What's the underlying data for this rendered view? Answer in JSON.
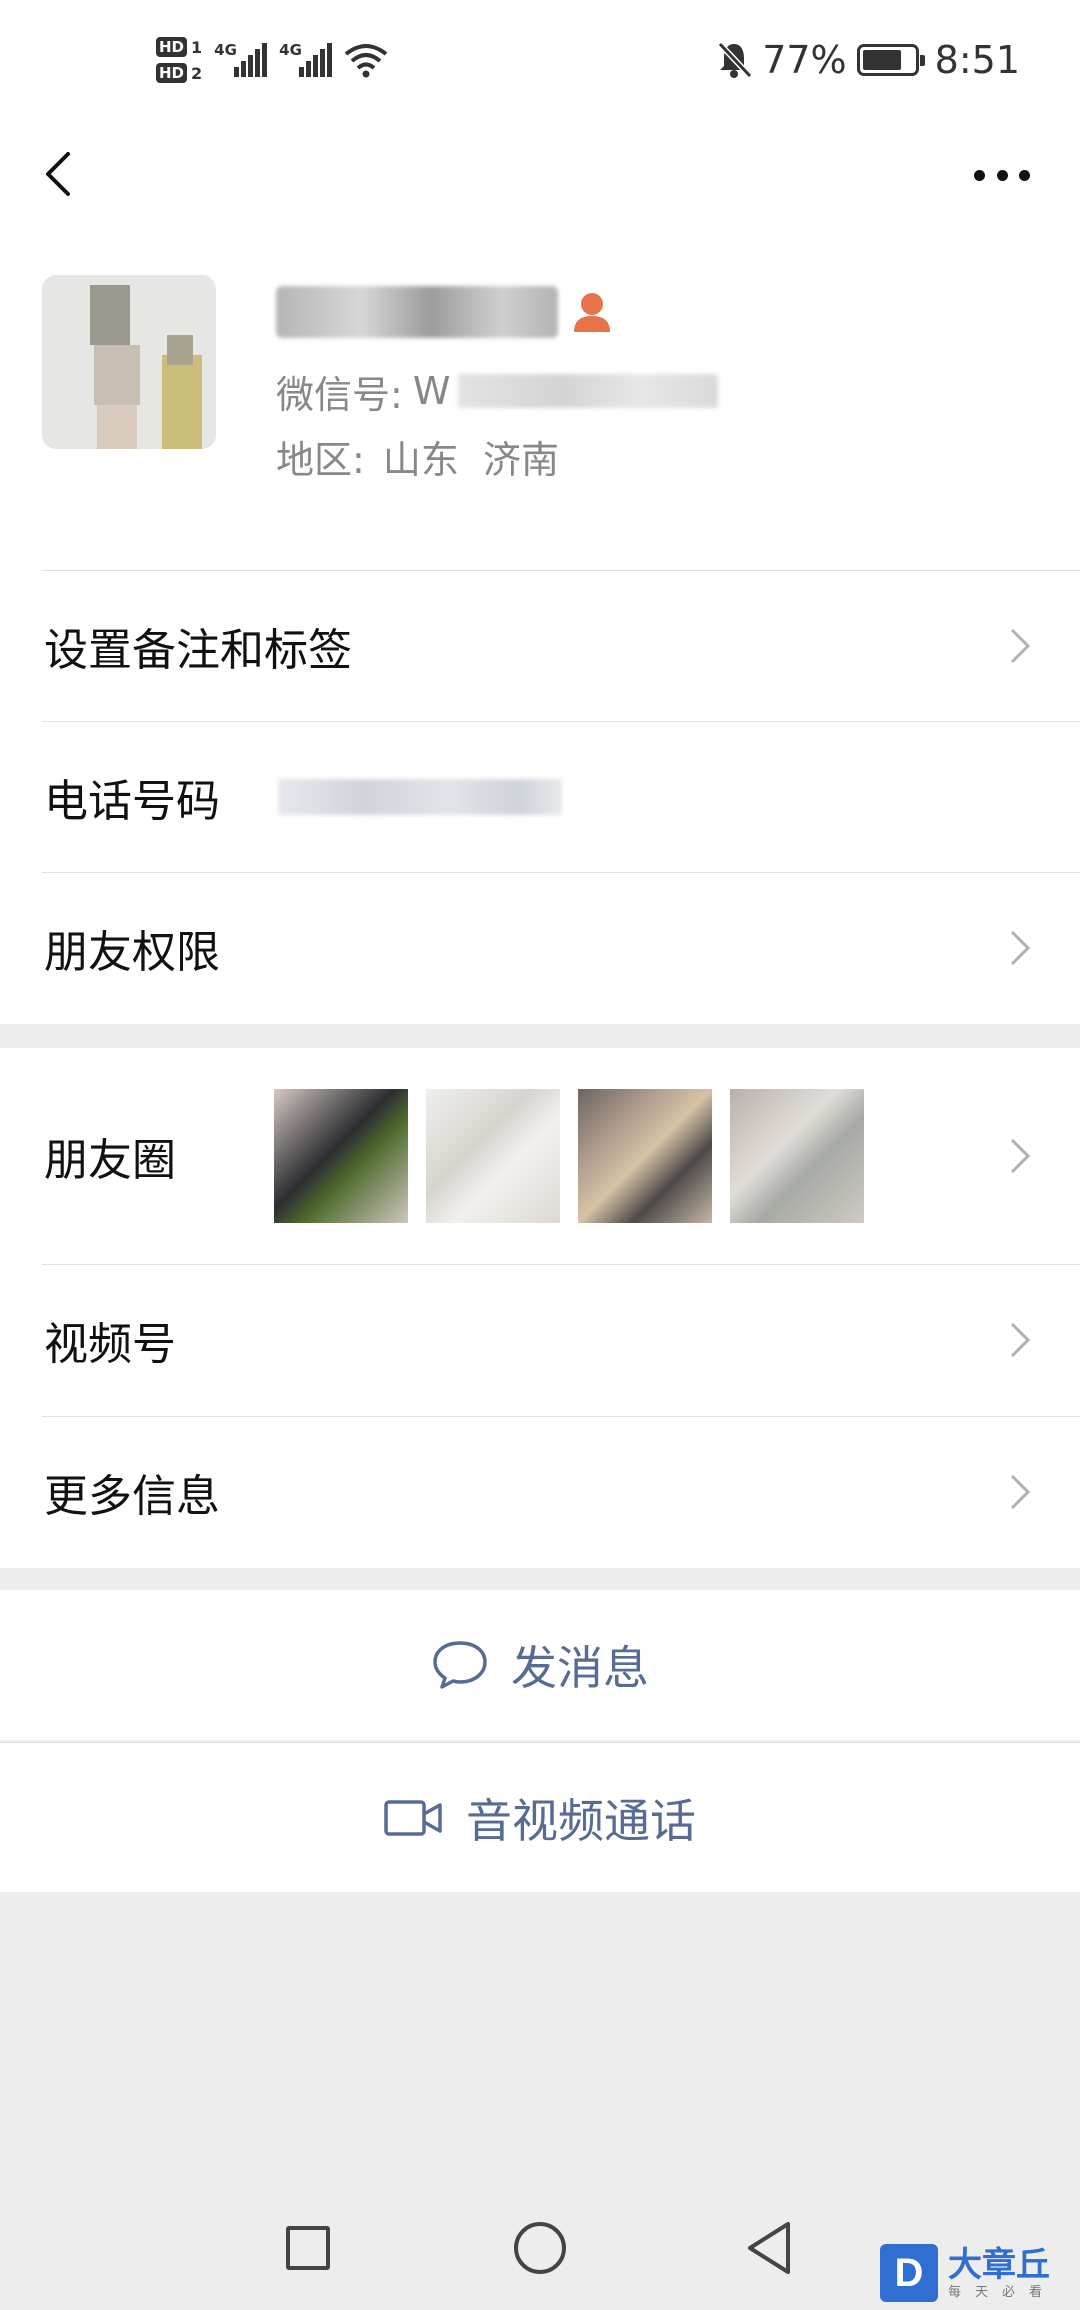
{
  "status_bar": {
    "hd1": "HD",
    "hd1_num": "1",
    "hd2": "HD",
    "hd2_num": "2",
    "net1": "4G",
    "net2": "4G",
    "battery": "77%",
    "battery_level": 0.77,
    "time": "8:51",
    "icons": [
      "signal-icon",
      "wifi-icon",
      "mute-bell-icon",
      "battery-icon"
    ]
  },
  "nav": {
    "back_icon": "back-chevron-icon",
    "more_icon": "more-dots-icon"
  },
  "profile": {
    "wechat_id_label": "微信号:",
    "wechat_id_prefix": "W",
    "region_label": "地区:",
    "region_value": "山东  济南",
    "nickname_icon": "person-icon"
  },
  "rows": {
    "remark": "设置备注和标签",
    "phone": "电话号码",
    "permissions": "朋友权限",
    "moments": "朋友圈",
    "channels": "视频号",
    "more_info": "更多信息"
  },
  "actions": {
    "message": "发消息",
    "call": "音视频通话"
  },
  "watermark": {
    "logo": "D",
    "title": "大章丘",
    "subtitle": "每天必看"
  },
  "colors": {
    "link": "#576b95",
    "background": "#ededed",
    "badge": "#e8734a"
  }
}
